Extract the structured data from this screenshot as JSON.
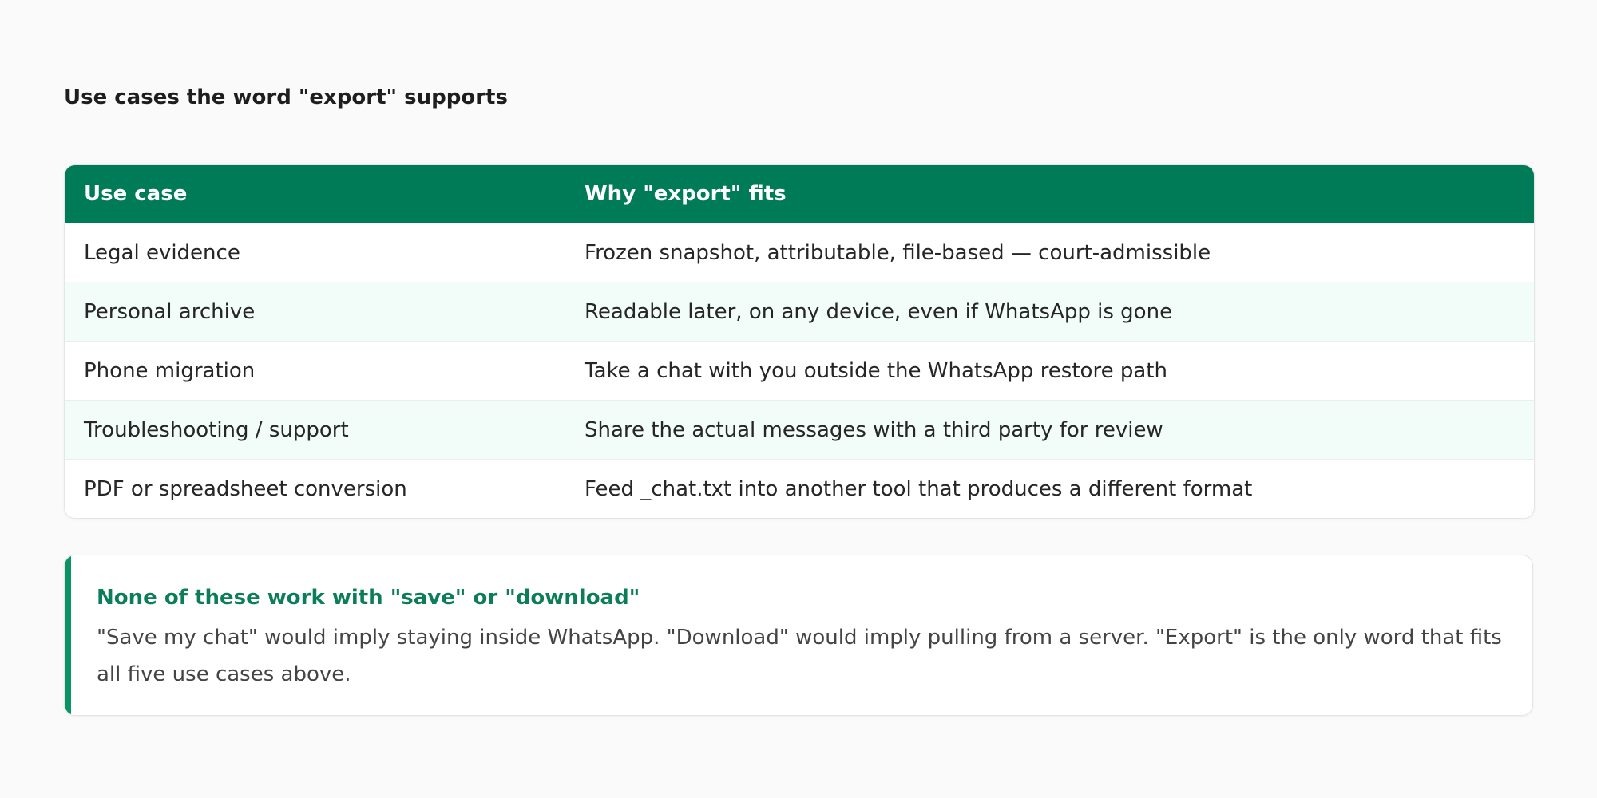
{
  "title": "Use cases the word \"export\" supports",
  "table": {
    "headers": [
      "Use case",
      "Why \"export\" fits"
    ],
    "rows": [
      {
        "use_case": "Legal evidence",
        "why": "Frozen snapshot, attributable, file-based — court-admissible"
      },
      {
        "use_case": "Personal archive",
        "why": "Readable later, on any device, even if WhatsApp is gone"
      },
      {
        "use_case": "Phone migration",
        "why": "Take a chat with you outside the WhatsApp restore path"
      },
      {
        "use_case": "Troubleshooting / support",
        "why": "Share the actual messages with a third party for review"
      },
      {
        "use_case": "PDF or spreadsheet conversion",
        "why": "Feed _chat.txt into another tool that produces a different format"
      }
    ]
  },
  "callout": {
    "heading": "None of these work with \"save\" or \"download\"",
    "body": "\"Save my chat\" would imply staying inside WhatsApp. \"Download\" would imply pulling from a server. \"Export\" is the only word that fits all five use cases above."
  },
  "colors": {
    "header_bg": "#007b58",
    "accent": "#0a9466",
    "callout_heading": "#0b7d58",
    "zebra_row": "#f2fcf8",
    "page_bg": "#fafafa"
  }
}
